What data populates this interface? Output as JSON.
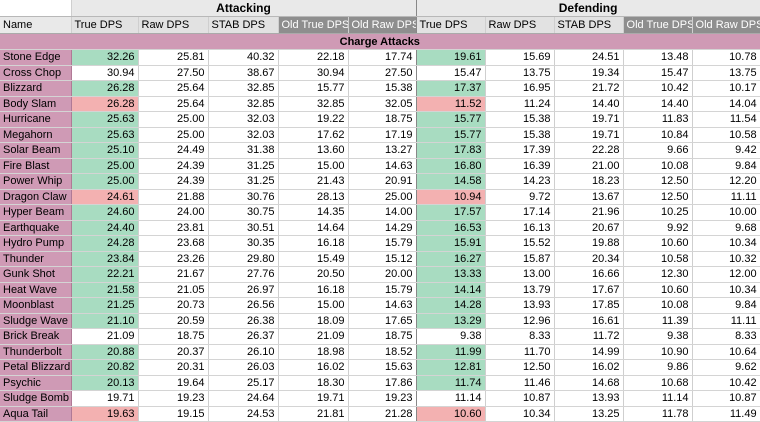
{
  "groups": {
    "attacking": "Attacking",
    "defending": "Defending"
  },
  "headers": {
    "name": "Name",
    "attacking": [
      "True DPS",
      "Raw DPS",
      "STAB DPS",
      "Old True DPS",
      "Old Raw DPS"
    ],
    "defending": [
      "True DPS",
      "Raw DPS",
      "STAB DPS",
      "Old True DPS",
      "Old Raw DPS"
    ]
  },
  "section": "Charge Attacks",
  "colors": {
    "name_bg": "#cf9ab5",
    "good": "#a8dcc1",
    "bad": "#f3b1b1",
    "old_header": "#8e8e8e"
  },
  "rows": [
    {
      "name": "Stone Edge",
      "att_hl": "g",
      "def_hl": "g",
      "att": [
        "32.26",
        "25.81",
        "40.32",
        "22.18",
        "17.74"
      ],
      "def": [
        "19.61",
        "15.69",
        "24.51",
        "13.48",
        "10.78"
      ]
    },
    {
      "name": "Cross Chop",
      "att_hl": "",
      "def_hl": "",
      "att": [
        "30.94",
        "27.50",
        "38.67",
        "30.94",
        "27.50"
      ],
      "def": [
        "15.47",
        "13.75",
        "19.34",
        "15.47",
        "13.75"
      ]
    },
    {
      "name": "Blizzard",
      "att_hl": "g",
      "def_hl": "g",
      "att": [
        "26.28",
        "25.64",
        "32.85",
        "15.77",
        "15.38"
      ],
      "def": [
        "17.37",
        "16.95",
        "21.72",
        "10.42",
        "10.17"
      ]
    },
    {
      "name": "Body Slam",
      "att_hl": "r",
      "def_hl": "r",
      "att": [
        "26.28",
        "25.64",
        "32.85",
        "32.85",
        "32.05"
      ],
      "def": [
        "11.52",
        "11.24",
        "14.40",
        "14.40",
        "14.04"
      ]
    },
    {
      "name": "Hurricane",
      "att_hl": "g",
      "def_hl": "g",
      "att": [
        "25.63",
        "25.00",
        "32.03",
        "19.22",
        "18.75"
      ],
      "def": [
        "15.77",
        "15.38",
        "19.71",
        "11.83",
        "11.54"
      ]
    },
    {
      "name": "Megahorn",
      "att_hl": "g",
      "def_hl": "g",
      "att": [
        "25.63",
        "25.00",
        "32.03",
        "17.62",
        "17.19"
      ],
      "def": [
        "15.77",
        "15.38",
        "19.71",
        "10.84",
        "10.58"
      ]
    },
    {
      "name": "Solar Beam",
      "att_hl": "g",
      "def_hl": "g",
      "att": [
        "25.10",
        "24.49",
        "31.38",
        "13.60",
        "13.27"
      ],
      "def": [
        "17.83",
        "17.39",
        "22.28",
        "9.66",
        "9.42"
      ]
    },
    {
      "name": "Fire Blast",
      "att_hl": "g",
      "def_hl": "g",
      "att": [
        "25.00",
        "24.39",
        "31.25",
        "15.00",
        "14.63"
      ],
      "def": [
        "16.80",
        "16.39",
        "21.00",
        "10.08",
        "9.84"
      ]
    },
    {
      "name": "Power Whip",
      "att_hl": "g",
      "def_hl": "g",
      "att": [
        "25.00",
        "24.39",
        "31.25",
        "21.43",
        "20.91"
      ],
      "def": [
        "14.58",
        "14.23",
        "18.23",
        "12.50",
        "12.20"
      ]
    },
    {
      "name": "Dragon Claw",
      "att_hl": "r",
      "def_hl": "r",
      "att": [
        "24.61",
        "21.88",
        "30.76",
        "28.13",
        "25.00"
      ],
      "def": [
        "10.94",
        "9.72",
        "13.67",
        "12.50",
        "11.11"
      ]
    },
    {
      "name": "Hyper Beam",
      "att_hl": "g",
      "def_hl": "g",
      "att": [
        "24.60",
        "24.00",
        "30.75",
        "14.35",
        "14.00"
      ],
      "def": [
        "17.57",
        "17.14",
        "21.96",
        "10.25",
        "10.00"
      ]
    },
    {
      "name": "Earthquake",
      "att_hl": "g",
      "def_hl": "g",
      "att": [
        "24.40",
        "23.81",
        "30.51",
        "14.64",
        "14.29"
      ],
      "def": [
        "16.53",
        "16.13",
        "20.67",
        "9.92",
        "9.68"
      ]
    },
    {
      "name": "Hydro Pump",
      "att_hl": "g",
      "def_hl": "g",
      "att": [
        "24.28",
        "23.68",
        "30.35",
        "16.18",
        "15.79"
      ],
      "def": [
        "15.91",
        "15.52",
        "19.88",
        "10.60",
        "10.34"
      ]
    },
    {
      "name": "Thunder",
      "att_hl": "g",
      "def_hl": "g",
      "att": [
        "23.84",
        "23.26",
        "29.80",
        "15.49",
        "15.12"
      ],
      "def": [
        "16.27",
        "15.87",
        "20.34",
        "10.58",
        "10.32"
      ]
    },
    {
      "name": "Gunk Shot",
      "att_hl": "g",
      "def_hl": "g",
      "att": [
        "22.21",
        "21.67",
        "27.76",
        "20.50",
        "20.00"
      ],
      "def": [
        "13.33",
        "13.00",
        "16.66",
        "12.30",
        "12.00"
      ]
    },
    {
      "name": "Heat Wave",
      "att_hl": "g",
      "def_hl": "g",
      "att": [
        "21.58",
        "21.05",
        "26.97",
        "16.18",
        "15.79"
      ],
      "def": [
        "14.14",
        "13.79",
        "17.67",
        "10.60",
        "10.34"
      ]
    },
    {
      "name": "Moonblast",
      "att_hl": "g",
      "def_hl": "g",
      "att": [
        "21.25",
        "20.73",
        "26.56",
        "15.00",
        "14.63"
      ],
      "def": [
        "14.28",
        "13.93",
        "17.85",
        "10.08",
        "9.84"
      ]
    },
    {
      "name": "Sludge Wave",
      "att_hl": "g",
      "def_hl": "g",
      "att": [
        "21.10",
        "20.59",
        "26.38",
        "18.09",
        "17.65"
      ],
      "def": [
        "13.29",
        "12.96",
        "16.61",
        "11.39",
        "11.11"
      ]
    },
    {
      "name": "Brick Break",
      "att_hl": "",
      "def_hl": "",
      "att": [
        "21.09",
        "18.75",
        "26.37",
        "21.09",
        "18.75"
      ],
      "def": [
        "9.38",
        "8.33",
        "11.72",
        "9.38",
        "8.33"
      ]
    },
    {
      "name": "Thunderbolt",
      "att_hl": "g",
      "def_hl": "g",
      "att": [
        "20.88",
        "20.37",
        "26.10",
        "18.98",
        "18.52"
      ],
      "def": [
        "11.99",
        "11.70",
        "14.99",
        "10.90",
        "10.64"
      ]
    },
    {
      "name": "Petal Blizzard",
      "att_hl": "g",
      "def_hl": "g",
      "att": [
        "20.82",
        "20.31",
        "26.03",
        "16.02",
        "15.63"
      ],
      "def": [
        "12.81",
        "12.50",
        "16.02",
        "9.86",
        "9.62"
      ]
    },
    {
      "name": "Psychic",
      "att_hl": "g",
      "def_hl": "g",
      "att": [
        "20.13",
        "19.64",
        "25.17",
        "18.30",
        "17.86"
      ],
      "def": [
        "11.74",
        "11.46",
        "14.68",
        "10.68",
        "10.42"
      ]
    },
    {
      "name": "Sludge Bomb",
      "att_hl": "",
      "def_hl": "",
      "att": [
        "19.71",
        "19.23",
        "24.64",
        "19.71",
        "19.23"
      ],
      "def": [
        "11.14",
        "10.87",
        "13.93",
        "11.14",
        "10.87"
      ]
    },
    {
      "name": "Aqua Tail",
      "att_hl": "r",
      "def_hl": "r",
      "att": [
        "19.63",
        "19.15",
        "24.53",
        "21.81",
        "21.28"
      ],
      "def": [
        "10.60",
        "10.34",
        "13.25",
        "11.78",
        "11.49"
      ]
    }
  ]
}
